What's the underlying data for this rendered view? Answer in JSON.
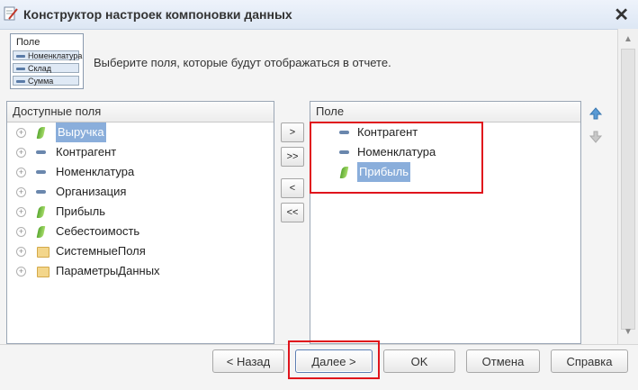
{
  "window": {
    "title": "Конструктор настроек компоновки данных",
    "close": "✕"
  },
  "header": {
    "thumb": {
      "title": "Поле",
      "rows": [
        "Номенклатура",
        "Склад",
        "Сумма"
      ]
    },
    "hint": "Выберите поля, которые будут отображаться в отчете."
  },
  "available": {
    "header": "Доступные поля",
    "items": [
      {
        "label": "Выручка",
        "icon": "resource-icon",
        "selected": true
      },
      {
        "label": "Контрагент",
        "icon": "property-icon"
      },
      {
        "label": "Номенклатура",
        "icon": "property-icon"
      },
      {
        "label": "Организация",
        "icon": "property-icon"
      },
      {
        "label": "Прибыль",
        "icon": "resource-icon"
      },
      {
        "label": "Себестоимость",
        "icon": "resource-icon"
      },
      {
        "label": "СистемныеПоля",
        "icon": "folder-icon"
      },
      {
        "label": "ПараметрыДанных",
        "icon": "folder-icon"
      }
    ]
  },
  "transfer": {
    "add": ">",
    "add_all": ">>",
    "remove": "<",
    "remove_all": "<<"
  },
  "selected": {
    "header": "Поле",
    "items": [
      {
        "label": "Контрагент",
        "icon": "property-icon"
      },
      {
        "label": "Номенклатура",
        "icon": "property-icon"
      },
      {
        "label": "Прибыль",
        "icon": "resource-icon",
        "selected": true
      }
    ]
  },
  "footer": {
    "back": "< Назад",
    "next": "Далее >",
    "ok": "OK",
    "cancel": "Отмена",
    "help": "Справка"
  }
}
